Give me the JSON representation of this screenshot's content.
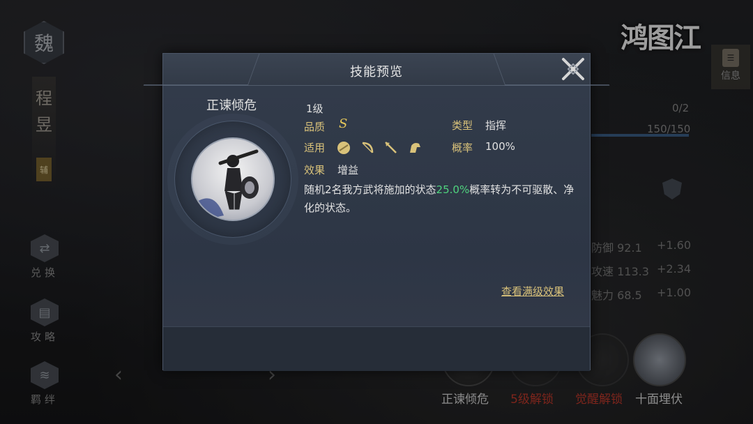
{
  "background": {
    "faction": "魏",
    "hero_name_chars": [
      "程",
      "昱"
    ],
    "hero_tag": "辅",
    "side_buttons": [
      {
        "label": "兑换",
        "icon": "exchange-icon"
      },
      {
        "label": "攻略",
        "icon": "scroll-icon"
      },
      {
        "label": "羁绊",
        "icon": "bond-icon"
      }
    ],
    "logo": "鸿图江",
    "info_label": "信息",
    "stats_top": {
      "count": "0/2",
      "hp": "150/150"
    },
    "attributes": [
      {
        "name": "防御",
        "value": "92.1",
        "bonus": "+1.60"
      },
      {
        "name": "攻速",
        "value": "113.3",
        "bonus": "+2.34"
      },
      {
        "name": "魅力",
        "value": "68.5",
        "bonus": "+1.00"
      }
    ],
    "skills": [
      {
        "label": "正谏倾危",
        "color": "#d8d8d8"
      },
      {
        "label": "5级解锁",
        "color": "#c0392b"
      },
      {
        "label": "觉醒解锁",
        "color": "#c0392b"
      },
      {
        "label": "十面埋伏",
        "color": "#d8d8d8"
      }
    ]
  },
  "modal": {
    "title": "技能预览",
    "skill_name": "正谏倾危",
    "level": "1级",
    "quality_label": "品质",
    "quality_value": "S",
    "type_label": "类型",
    "type_value": "指挥",
    "apply_label": "适用",
    "apply_icons": [
      "shield-unit-icon",
      "bow-unit-icon",
      "spear-unit-icon",
      "cavalry-unit-icon"
    ],
    "rate_label": "概率",
    "rate_value": "100%",
    "effect_label": "效果",
    "effect_value": "增益",
    "desc_pre": "随机2名我方武将施加的状态",
    "desc_highlight": "25.0%",
    "desc_post": "概率转为不可驱散、净化的状态。",
    "view_max_link": "查看满级效果"
  },
  "colors": {
    "accent_gold": "#d9c27a",
    "highlight_green": "#4fd37e",
    "locked_red": "#c0392b"
  }
}
